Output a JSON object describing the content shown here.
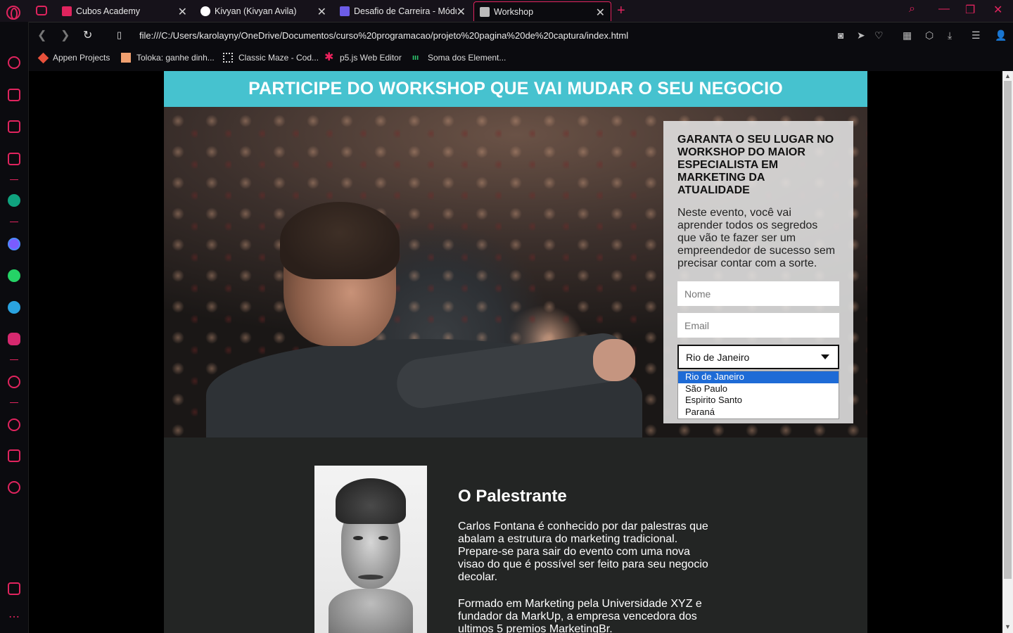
{
  "browser": {
    "tabs": [
      {
        "title": "Cubos Academy",
        "favicon_color": "#e0245e"
      },
      {
        "title": "Kivyan (Kivyan Avila)",
        "favicon_color": "#ffffff"
      },
      {
        "title": "Desafio de Carreira - Módu",
        "favicon_color": "#6c5ce7"
      },
      {
        "title": "Workshop",
        "favicon_color": "#cccccc"
      }
    ],
    "url": "file:///C:/Users/karolayny/OneDrive/Documentos/curso%20programacao/projeto%20pagina%20de%20captura/index.html",
    "bookmarks": [
      {
        "label": "Appen Projects",
        "icon_color": "#e8513b"
      },
      {
        "label": "Toloka: ganhe dinh...",
        "icon_color": "#f0a070"
      },
      {
        "label": "Classic Maze - Cod...",
        "icon_color": "#dddddd"
      },
      {
        "label": "p5.js Web Editor",
        "icon_color": "#ed225d"
      },
      {
        "label": "Soma dos Element...",
        "icon_color": "#2ecc71"
      }
    ],
    "accent_color": "#e0245e"
  },
  "page": {
    "banner_title": "PARTICIPE DO WORKSHOP QUE VAI MUDAR O SEU NEGOCIO",
    "banner_color": "#46c2cf",
    "form": {
      "title": "GARANTA O SEU LUGAR NO WORKSHOP DO MAIOR ESPECIALISTA EM MARKETING DA ATUALIDADE",
      "description": "Neste evento, você vai aprender todos os segredos que vão te fazer ser um empreendedor de sucesso sem precisar contar com a sorte.",
      "name_placeholder": "Nome",
      "email_placeholder": "Email",
      "state_selected": "Rio de Janeiro",
      "state_options": [
        "Rio de Janeiro",
        "São Paulo",
        "Espirito Santo",
        "Paraná"
      ]
    },
    "speaker": {
      "heading": "O Palestrante",
      "paragraph_1": "Carlos Fontana é conhecido por dar palestras que abalam a estrutura do marketing tradicional. Prepare-se para sair do evento com uma nova visao do que é possível ser feito para seu negocio decolar.",
      "paragraph_2": "Formado em Marketing pela Universidade XYZ e fundador da MarkUp, a empresa vencedora dos ultimos 5 premios MarketingBr."
    }
  }
}
